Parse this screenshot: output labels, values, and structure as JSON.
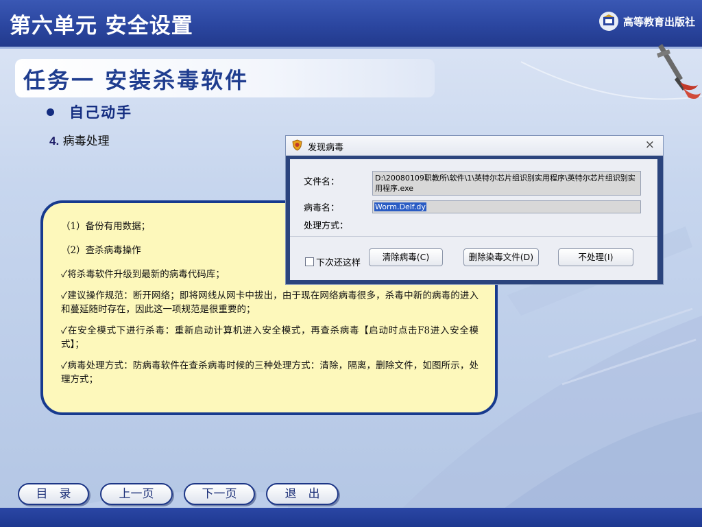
{
  "header": {
    "title": "第六单元 安全设置",
    "publisher": "高等教育出版社"
  },
  "task": {
    "title": "任务一 安装杀毒软件"
  },
  "bullet": {
    "text": "自己动手"
  },
  "step": {
    "number": "4.",
    "label": "病毒处理"
  },
  "notes": [
    "（1）备份有用数据；",
    "（2）查杀病毒操作",
    "✓将杀毒软件升级到最新的病毒代码库；",
    "✓建议操作规范：断开网络；即将网线从网卡中拔出，由于现在网络病毒很多，杀毒中新的病毒的进入和蔓延随时存在，因此这一项规范是很重要的；",
    "✓在安全模式下进行杀毒：重新启动计算机进入安全模式，再查杀病毒【启动时点击F8进入安全模式】；",
    "✓病毒处理方式：防病毒软件在查杀病毒时候的三种处理方式：清除，隔离，删除文件，如图所示，处理方式；"
  ],
  "dialog": {
    "title": "发现病毒",
    "close": "×",
    "file_label": "文件名：",
    "file_value": "D:\\20080109职教所\\软件\\1\\英特尔芯片组识别实用程序\\英特尔芯片组识别实用程序.exe",
    "virus_label": "病毒名：",
    "virus_value": "Worm.Delf.dy",
    "method_label": "处理方式：",
    "checkbox_label": "下次还这样",
    "buttons": {
      "clean": "清除病毒(C)",
      "delete": "删除染毒文件(D)",
      "ignore": "不处理(I)"
    }
  },
  "nav": {
    "toc": "目　录",
    "prev": "上一页",
    "next": "下一页",
    "exit": "退　出"
  },
  "colors": {
    "header_bg": "#2b46a0",
    "notes_bg": "#fdf8bb",
    "notes_border": "#173a8e",
    "title_text": "#1f3d8f"
  }
}
